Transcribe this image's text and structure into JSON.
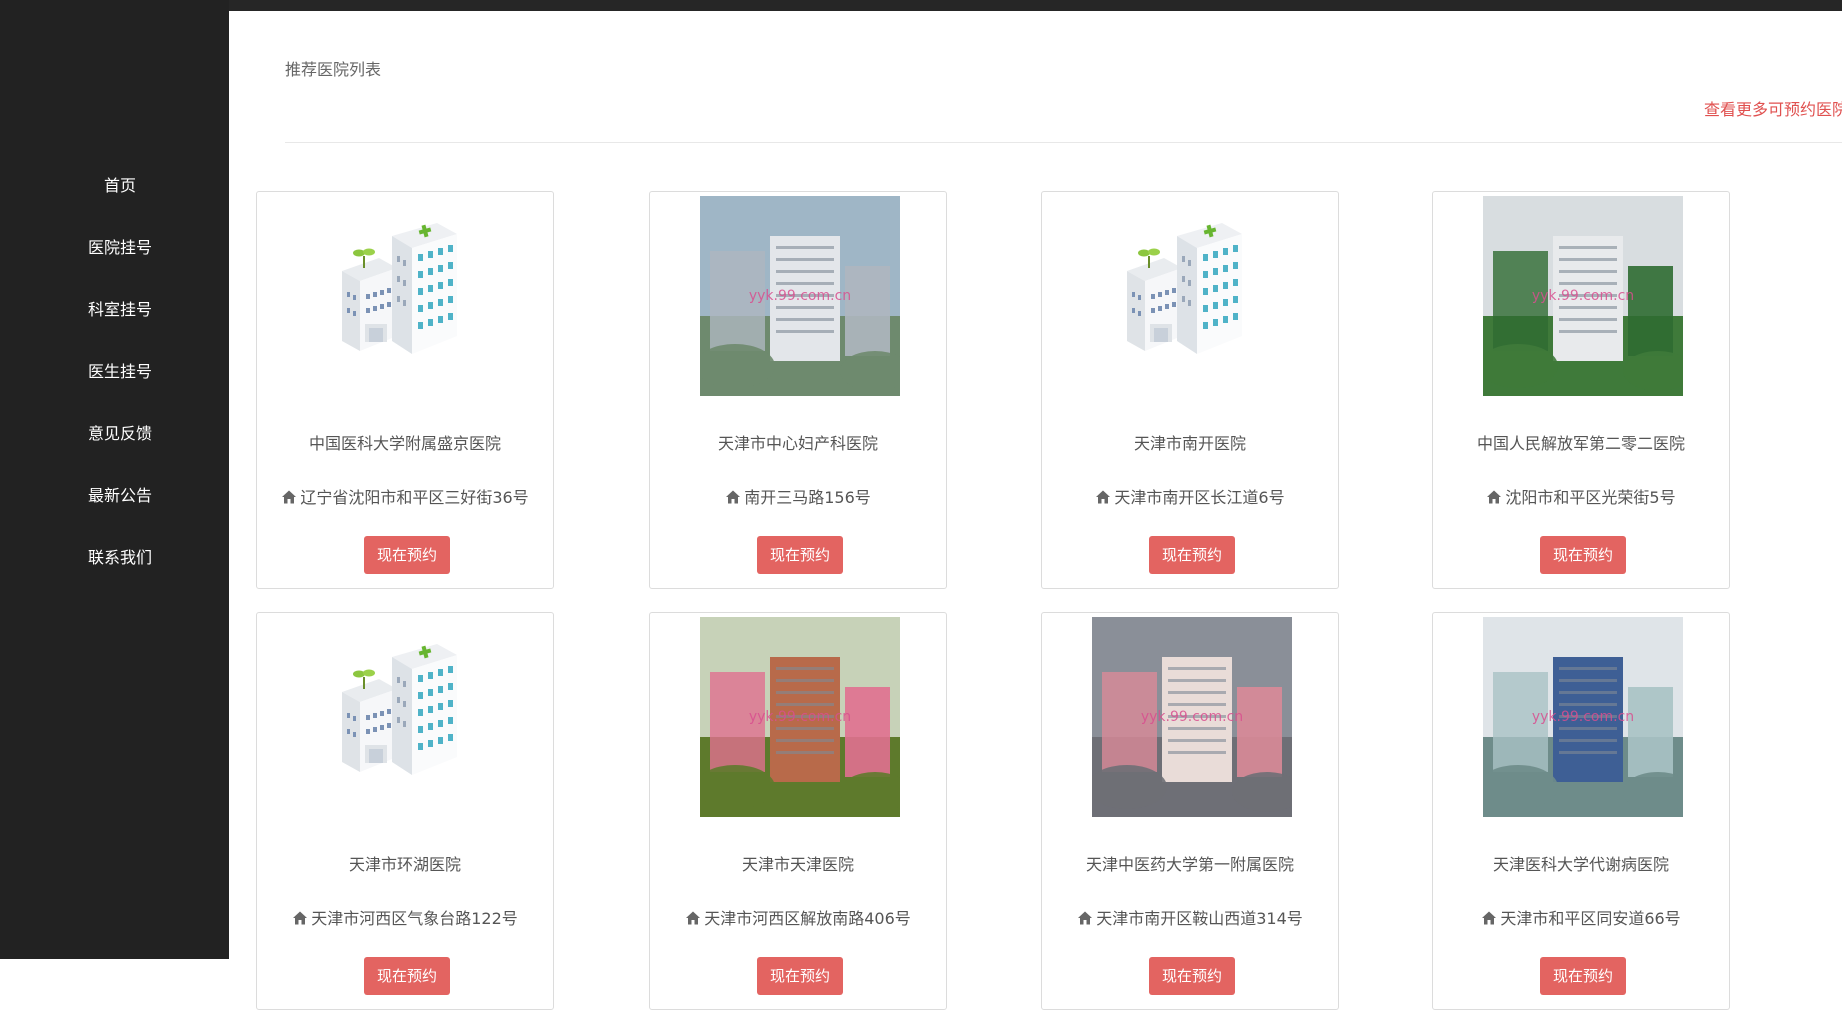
{
  "sidebar": {
    "items": [
      {
        "label": "首页"
      },
      {
        "label": "医院挂号"
      },
      {
        "label": "科室挂号"
      },
      {
        "label": "医生挂号"
      },
      {
        "label": "意见反馈"
      },
      {
        "label": "最新公告"
      },
      {
        "label": "联系我们"
      }
    ]
  },
  "header": {
    "title": "推荐医院列表",
    "more_link": "查看更多可预约医院"
  },
  "hospitals": [
    {
      "name": "中国医科大学附属盛京医院",
      "address": "辽宁省沈阳市和平区三好街36号",
      "image": "hospital-placeholder-icon",
      "button": "现在预约"
    },
    {
      "name": "天津市中心妇产科医院",
      "address": "南开三马路156号",
      "image": "hospital-photo",
      "button": "现在预约"
    },
    {
      "name": "天津市南开医院",
      "address": "天津市南开区长江道6号",
      "image": "hospital-placeholder-icon",
      "button": "现在预约"
    },
    {
      "name": "中国人民解放军第二零二医院",
      "address": "沈阳市和平区光荣街5号",
      "image": "hospital-photo",
      "button": "现在预约"
    },
    {
      "name": "天津市环湖医院",
      "address": "天津市河西区气象台路122号",
      "image": "hospital-placeholder-icon",
      "button": "现在预约"
    },
    {
      "name": "天津市天津医院",
      "address": "天津市河西区解放南路406号",
      "image": "hospital-photo",
      "button": "现在预约"
    },
    {
      "name": "天津中医药大学第一附属医院",
      "address": "天津市南开区鞍山西道314号",
      "image": "hospital-photo",
      "button": "现在预约"
    },
    {
      "name": "天津医科大学代谢病医院",
      "address": "天津市和平区同安道66号",
      "image": "hospital-photo",
      "button": "现在预约"
    }
  ],
  "watermark": "yyk.99.com.cn",
  "colors": {
    "sidebar_bg": "#222222",
    "accent": "#e36461",
    "link": "#e0504f"
  }
}
